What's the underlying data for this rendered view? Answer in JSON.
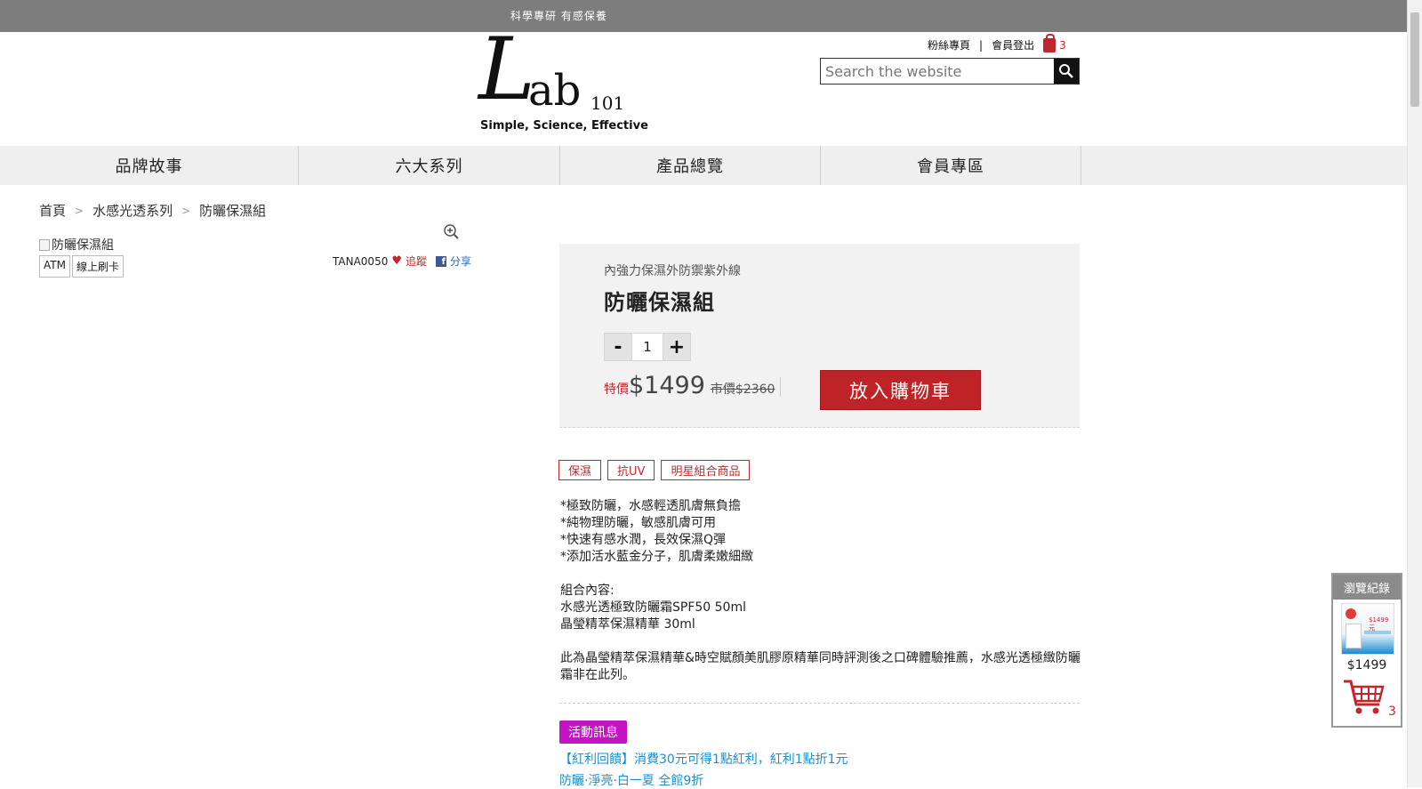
{
  "topbar": {
    "slogan": "科學專研 有感保養"
  },
  "logo": {
    "big": "L",
    "ab": "ab",
    "num": "101",
    "tagline": "Simple, Science, Effective"
  },
  "header": {
    "fans_link": "粉絲專頁",
    "separator": "|",
    "logout_link": "會員登出",
    "cart_count": "3",
    "search_placeholder": "Search the website"
  },
  "nav": {
    "items": [
      {
        "label": "品牌故事"
      },
      {
        "label": "六大系列"
      },
      {
        "label": "產品總覽"
      },
      {
        "label": "會員專區"
      }
    ]
  },
  "breadcrumb": {
    "home": "首頁",
    "sep1": ">",
    "series": "水感光透系列",
    "sep2": ">",
    "current": "防曬保濕組"
  },
  "product": {
    "image_alt": "防曬保濕組",
    "payment_tags": [
      "ATM",
      "線上刷卡"
    ],
    "code": "TANA0050",
    "track_label": "追蹤",
    "share_label": "分享",
    "subtitle": "內強力保濕外防禦紫外線",
    "name": "防曬保濕組",
    "qty_minus": "-",
    "qty_value": "1",
    "qty_plus": "+",
    "price_label": "特價",
    "price": "$1499",
    "original_price": "市價$2360",
    "add_to_cart": "放入購物車",
    "tags": [
      "保濕",
      "抗UV",
      "明星組合商品"
    ],
    "description": {
      "l1": "*極致防曬，水感輕透肌膚無負擔",
      "l2": "*純物理防曬，敏感肌膚可用",
      "l3": "*快速有感水潤，長效保濕Q彈",
      "l4": "*添加活水藍金分子，肌膚柔嫩細緻",
      "set_title": "組合內容:",
      "set1": "水感光透極致防曬霜SPF50 50ml",
      "set2": "晶瑩精萃保濕精華 30ml",
      "note": "此為晶瑩精萃保濕精華&時空賦顏美肌膠原精華同時評測後之口碑體驗推薦，水感光透極緻防曬霜非在此列。"
    },
    "event_badge": "活動訊息",
    "event1": "【紅利回饋】消費30元可得1點紅利，紅利1點折1元",
    "event2": "防曬·淨亮·白一夏 全館9折"
  },
  "history": {
    "title": "瀏覽紀錄",
    "thumb_price": "$1499元",
    "price": "$1499",
    "cart_count": "3"
  },
  "colors": {
    "accent_red": "#bd2327",
    "event_purple": "#c313c3",
    "link_blue": "#1a8fd1",
    "topbar_gray": "#7d7d7d"
  }
}
